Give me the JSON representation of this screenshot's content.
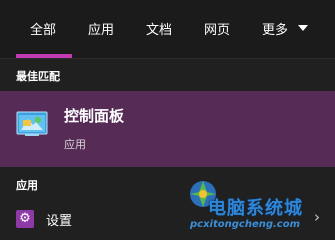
{
  "tabs": [
    {
      "label": "全部"
    },
    {
      "label": "应用"
    },
    {
      "label": "文档"
    },
    {
      "label": "网页"
    },
    {
      "label": "更多"
    }
  ],
  "active_tab": "全部",
  "accent_color": "#c239b3",
  "best_match": {
    "section_label": "最佳匹配",
    "title": "控制面板",
    "subtitle": "应用",
    "icon": "control-panel-icon",
    "highlight_color": "#562b55"
  },
  "apps": {
    "section_label": "应用",
    "items": [
      {
        "label": "设置",
        "icon": "gear-icon"
      }
    ]
  },
  "watermark": {
    "text": "电脑系统城",
    "url": "pcxitongcheng.com"
  }
}
